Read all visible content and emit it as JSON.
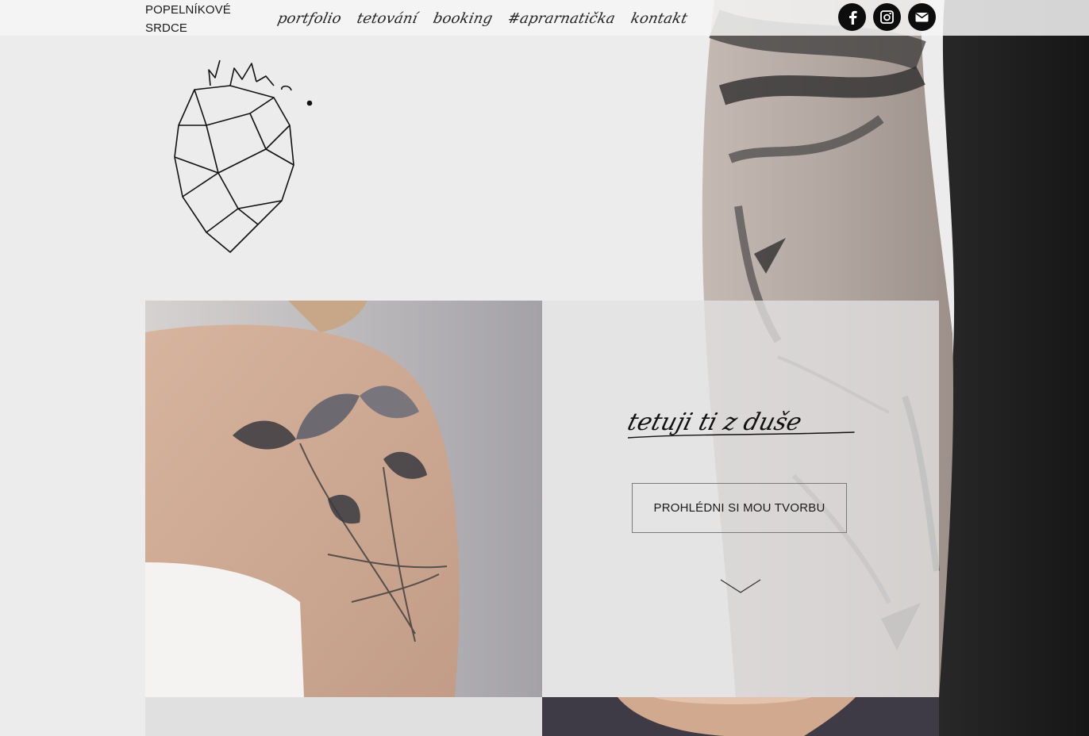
{
  "brand": {
    "line1": "POPELNÍKOVÉ",
    "line2": "SRDCE"
  },
  "nav": {
    "items": [
      {
        "label": "portfolio",
        "name": "nav-portfolio"
      },
      {
        "label": "tetování",
        "name": "nav-tetovani"
      },
      {
        "label": "booking",
        "name": "nav-booking"
      },
      {
        "label": "#aprarnatička",
        "name": "nav-aprarnaticka"
      },
      {
        "label": "kontakt",
        "name": "nav-kontakt"
      }
    ]
  },
  "social": {
    "facebook_icon": "facebook-icon",
    "instagram_icon": "instagram-icon",
    "email_icon": "envelope-icon"
  },
  "hero": {
    "tagline": "tetuji ti z duše",
    "cta_label": "PROHLÉDNI SI MOU TVORBU"
  },
  "colors": {
    "page_bg": "#ececec",
    "text": "#111111",
    "social_bg": "#0d0d0d"
  }
}
